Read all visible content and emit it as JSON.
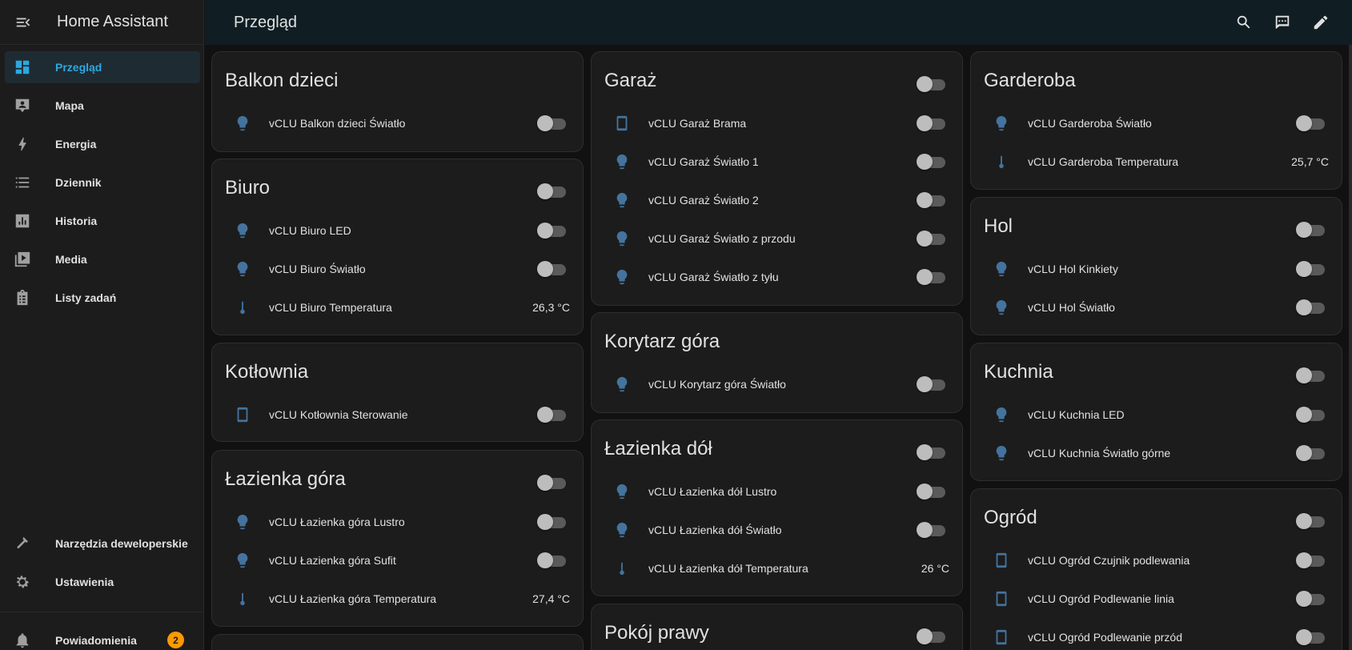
{
  "colors": {
    "accent": "#2ba8e0",
    "entity_icon": "#44739e",
    "badge": "#ff9800"
  },
  "sidebar": {
    "title": "Home Assistant",
    "items": [
      {
        "label": "Przegląd",
        "icon": "dashboard-icon",
        "active": true
      },
      {
        "label": "Mapa",
        "icon": "map-account-icon"
      },
      {
        "label": "Energia",
        "icon": "lightning-icon"
      },
      {
        "label": "Dziennik",
        "icon": "list-icon"
      },
      {
        "label": "Historia",
        "icon": "chart-box-icon"
      },
      {
        "label": "Media",
        "icon": "media-icon"
      },
      {
        "label": "Listy zadań",
        "icon": "clipboard-list-icon"
      }
    ],
    "developer_tools": "Narzędzia deweloperskie",
    "settings": "Ustawienia",
    "notifications": {
      "label": "Powiadomienia",
      "count": "2"
    }
  },
  "header": {
    "title": "Przegląd"
  },
  "cards": {
    "balkon": {
      "title": "Balkon dzieci",
      "e0": "vCLU Balkon dzieci Światło"
    },
    "biuro": {
      "title": "Biuro",
      "e0": "vCLU Biuro LED",
      "e1": "vCLU Biuro Światło",
      "e2": "vCLU Biuro Temperatura",
      "v2": "26,3 °C"
    },
    "kotlownia": {
      "title": "Kotłownia",
      "e0": "vCLU Kotłownia Sterowanie"
    },
    "lazienka_gora": {
      "title": "Łazienka góra",
      "e0": "vCLU Łazienka góra Lustro",
      "e1": "vCLU Łazienka góra Sufit",
      "e2": "vCLU Łazienka góra Temperatura",
      "v2": "27,4 °C"
    },
    "garaz": {
      "title": "Garaż",
      "e0": "vCLU Garaż Brama",
      "e1": "vCLU Garaż Światło 1",
      "e2": "vCLU Garaż Światło 2",
      "e3": "vCLU Garaż Światło z przodu",
      "e4": "vCLU Garaż Światło z tyłu"
    },
    "korytarz": {
      "title": "Korytarz góra",
      "e0": "vCLU Korytarz góra Światło"
    },
    "lazienka_dol": {
      "title": "Łazienka dół",
      "e0": "vCLU Łazienka dół Lustro",
      "e1": "vCLU Łazienka dół Światło",
      "e2": "vCLU Łazienka dół Temperatura",
      "v2": "26 °C"
    },
    "pokoj_prawy": {
      "title": "Pokój prawy"
    },
    "garderoba": {
      "title": "Garderoba",
      "e0": "vCLU Garderoba Światło",
      "e1": "vCLU Garderoba Temperatura",
      "v1": "25,7 °C"
    },
    "hol": {
      "title": "Hol",
      "e0": "vCLU Hol Kinkiety",
      "e1": "vCLU Hol Światło"
    },
    "kuchnia": {
      "title": "Kuchnia",
      "e0": "vCLU Kuchnia LED",
      "e1": "vCLU Kuchnia Światło górne"
    },
    "ogrod": {
      "title": "Ogród",
      "e0": "vCLU Ogród Czujnik podlewania",
      "e1": "vCLU Ogród Podlewanie linia",
      "e2": "vCLU Ogród Podlewanie przód"
    }
  }
}
